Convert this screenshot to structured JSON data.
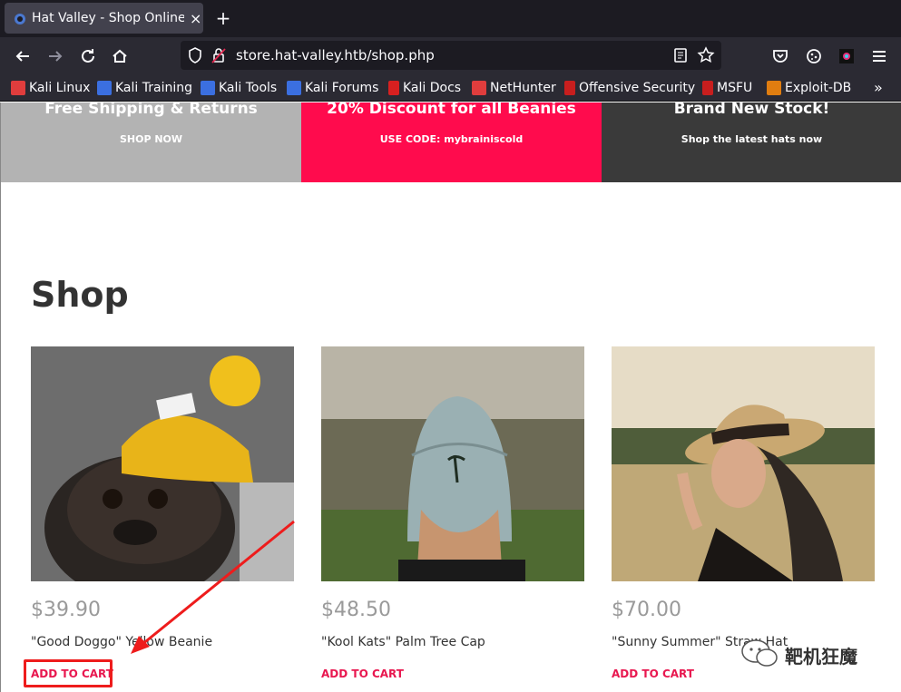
{
  "tab": {
    "title": "Hat Valley - Shop Online!",
    "close": "×",
    "new_tab": "+"
  },
  "nav": {
    "url": "store.hat-valley.htb/shop.php"
  },
  "bookmarks": [
    {
      "label": "Kali Linux",
      "color": "#e03d3d"
    },
    {
      "label": "Kali Training",
      "color": "#3b6fe0"
    },
    {
      "label": "Kali Tools",
      "color": "#3b6fe0"
    },
    {
      "label": "Kali Forums",
      "color": "#3b6fe0"
    },
    {
      "label": "Kali Docs",
      "color": "#d82020"
    },
    {
      "label": "NetHunter",
      "color": "#e03d3d"
    },
    {
      "label": "Offensive Security",
      "color": "#c81e1e"
    },
    {
      "label": "MSFU",
      "color": "#c81e1e"
    },
    {
      "label": "Exploit-DB",
      "color": "#e07d10"
    }
  ],
  "banners": [
    {
      "title": "Free Shipping & Returns",
      "subtitle": "SHOP NOW",
      "bg": "#b3b3b3"
    },
    {
      "title": "20% Discount for all Beanies",
      "subtitle": "USE CODE: mybrainiscold",
      "bg": "#ff0b4d"
    },
    {
      "title": "Brand New Stock!",
      "subtitle": "Shop the latest hats now",
      "bg": "#3a3a3a"
    }
  ],
  "shop": {
    "heading": "Shop"
  },
  "products": [
    {
      "price": "$39.90",
      "name": "\"Good Doggo\" Yellow Beanie",
      "cart_label": "ADD TO CART"
    },
    {
      "price": "$48.50",
      "name": "\"Kool Kats\" Palm Tree Cap",
      "cart_label": "ADD TO CART"
    },
    {
      "price": "$70.00",
      "name": "\"Sunny Summer\" Straw Hat",
      "cart_label": "ADD TO CART"
    }
  ],
  "watermark": {
    "text": "靶机狂魔"
  },
  "colors": {
    "annotation_red": "#ee1c1c",
    "accent_pink": "#e8174f"
  }
}
